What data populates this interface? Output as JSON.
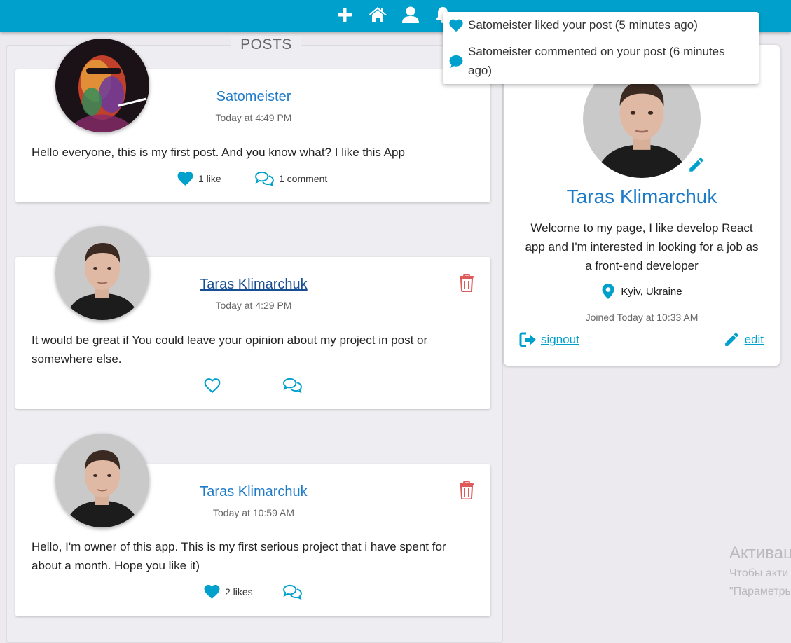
{
  "notifications": [
    {
      "text": "Satomeister liked your post (5 minutes ago)",
      "icon": "heart-icon"
    },
    {
      "text": "Satomeister commented on your post (6 minutes ago)",
      "icon": "chat-icon"
    }
  ],
  "posts_panel": {
    "title": "POSTS"
  },
  "posts": [
    {
      "author": "Satomeister",
      "time": "Today at 4:49 PM",
      "body": "Hello everyone, this is my first post. And you know what? I like this App",
      "likes_label": "1 like",
      "comments_label": "1 comment"
    },
    {
      "author": "Taras Klimarchuk",
      "time": "Today at 4:29 PM",
      "body": "It would be great if You could leave your opinion about my project in post or somewhere else."
    },
    {
      "author": "Taras Klimarchuk",
      "time": "Today at 10:59 AM",
      "body": "Hello, I'm owner of this app. This is my first serious project that i have spent for about a month. Hope you like it)",
      "likes_label": "2 likes"
    }
  ],
  "profile": {
    "name": "Taras Klimarchuk",
    "bio": "Welcome to my page, I like develop React app and I'm interested in looking for a job as a front-end developer",
    "location": "Kyiv, Ukraine",
    "joined": "Joined Today at 10:33 AM",
    "signout_label": "signout",
    "edit_label": "edit"
  },
  "watermark": {
    "line1": "Активац",
    "line2": "Чтобы акти",
    "line3": "\"Параметры"
  },
  "colors": {
    "topbar": "#00a0cc",
    "accent": "#00a0cc",
    "link": "#1e7bc8",
    "delete": "#e05a5a"
  }
}
